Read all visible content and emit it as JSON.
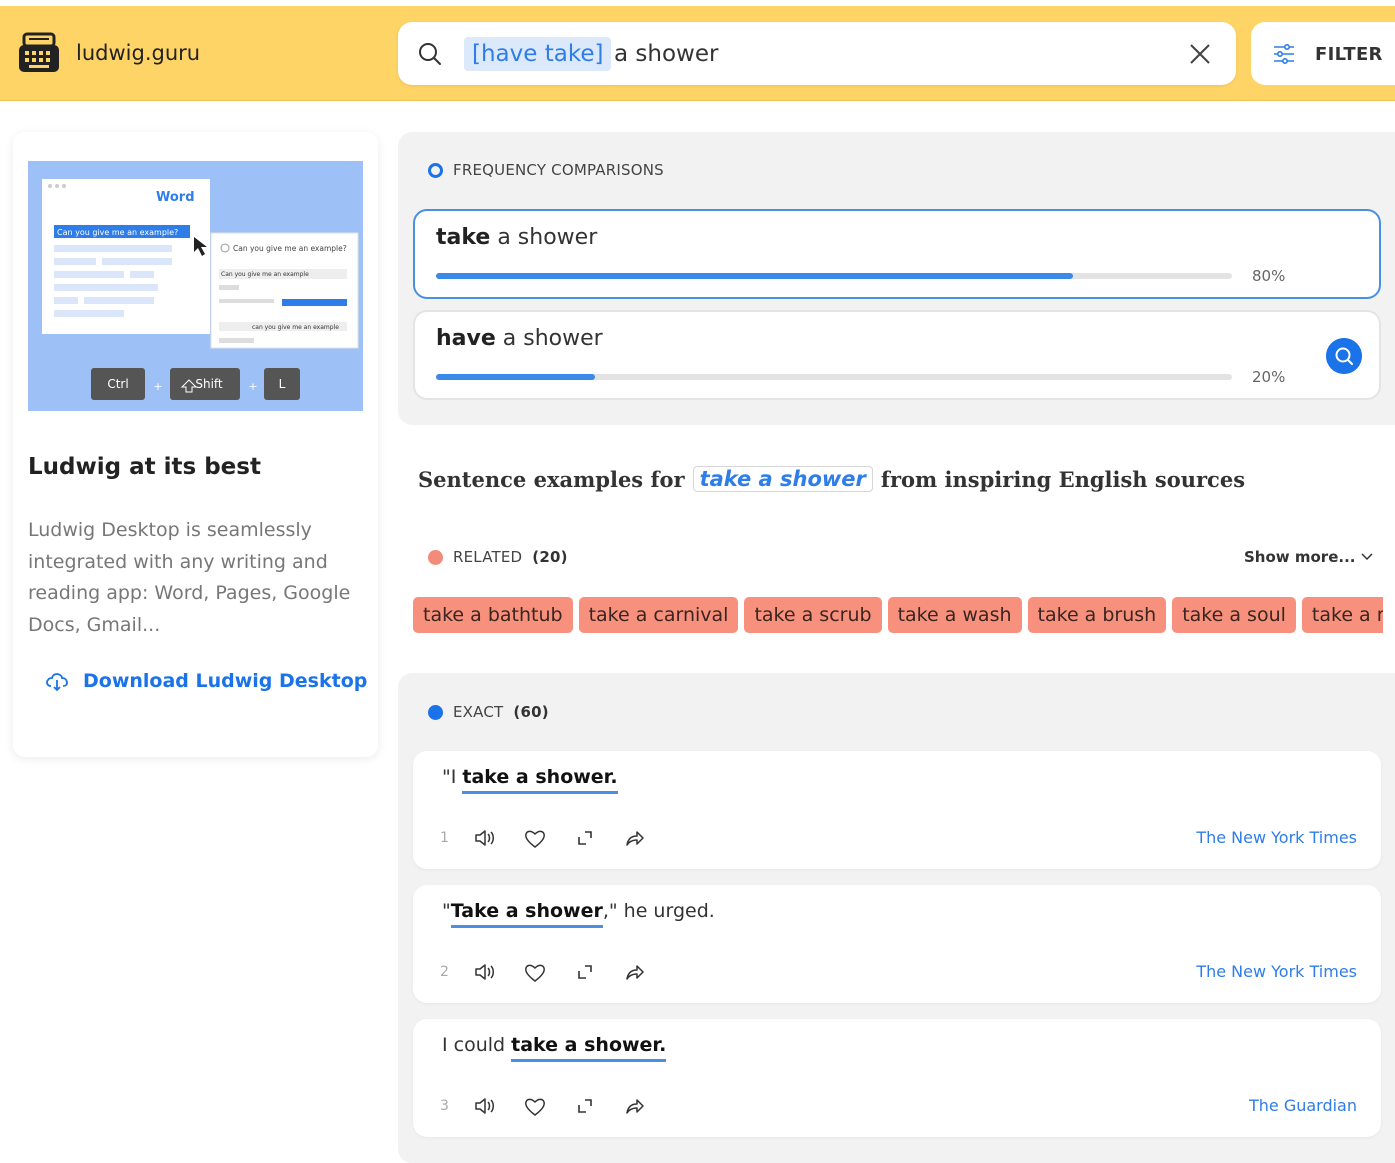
{
  "header": {
    "brand": "ludwig.guru",
    "search": {
      "chip": "[have take]",
      "rest": "a shower"
    },
    "filter_label": "FILTER"
  },
  "promo": {
    "image": {
      "window_title": "Word",
      "selected_text": "Can you give me an example?",
      "panel_query": "Can you give me an example?",
      "panel_item_1": "Can you give me an example",
      "panel_item_2": "can you give me an example",
      "keys": [
        "Ctrl",
        "Shift",
        "L"
      ]
    },
    "title": "Ludwig at its best",
    "text": "Ludwig Desktop is seamlessly integrated with any writing and reading app: Word, Pages, Google Docs, Gmail...",
    "link": "Download Ludwig Desktop"
  },
  "frequency": {
    "label": "FREQUENCY COMPARISONS",
    "items": [
      {
        "bold": "take",
        "rest": "a shower",
        "percent": 80,
        "percent_label": "80%",
        "active": true
      },
      {
        "bold": "have",
        "rest": "a shower",
        "percent": 20,
        "percent_label": "20%",
        "active": false
      }
    ]
  },
  "examples_heading": {
    "before": "Sentence examples for",
    "chip": "take a shower",
    "after": "from inspiring English sources"
  },
  "related": {
    "label": "RELATED",
    "count": "(20)",
    "show_more": "Show more...",
    "tags": [
      "take a bathtub",
      "take a carnival",
      "take a scrub",
      "take a wash",
      "take a brush",
      "take a soul",
      "take a mixe"
    ]
  },
  "exact": {
    "label": "EXACT",
    "count": "(60)",
    "items": [
      {
        "num": "1",
        "pre": "\"I ",
        "hl": "take a shower.",
        "post": "",
        "source": "The New York Times"
      },
      {
        "num": "2",
        "pre": "\"",
        "hl": "Take a shower",
        "post": ",\" he urged.",
        "source": "The New York Times"
      },
      {
        "num": "3",
        "pre": "I could ",
        "hl": "take a shower.",
        "post": "",
        "source": "The Guardian"
      }
    ]
  },
  "colors": {
    "header_bg": "#ffd466",
    "accent_blue": "#1a73e8",
    "tag_salmon": "#f7917e"
  }
}
